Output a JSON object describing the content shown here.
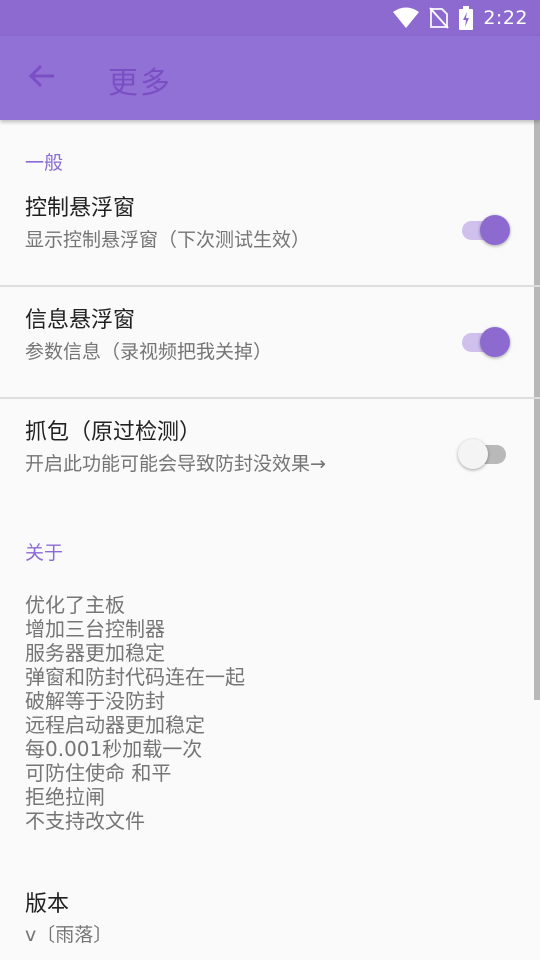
{
  "status_bar": {
    "time": "2:22",
    "icons": [
      "wifi-icon",
      "no-sim-icon",
      "battery-charging-icon"
    ]
  },
  "app_bar": {
    "back_icon": "arrow-left-icon",
    "title": "更多"
  },
  "sections": {
    "general_header": "一般",
    "about_header": "关于"
  },
  "preferences": [
    {
      "title": "控制悬浮窗",
      "summary": "显示控制悬浮窗（下次测试生效）",
      "checked": true
    },
    {
      "title": "信息悬浮窗",
      "summary": "参数信息（录视频把我关掉）",
      "checked": true
    },
    {
      "title": "抓包（原过检测）",
      "summary": "开启此功能可能会导致防封没效果→",
      "checked": false
    }
  ],
  "about_lines": [
    "优化了主板",
    "增加三台控制器",
    "服务器更加稳定",
    "弹窗和防封代码连在一起",
    "破解等于没防封",
    "远程启动器更加稳定",
    "每0.001秒加载一次",
    "可防住使命 和平",
    "拒绝拉闸",
    "不支持改文件"
  ],
  "version": {
    "title": "版本",
    "value": "v〔雨落〕"
  },
  "colors": {
    "status_bar": "#8c6ad0",
    "app_bar": "#9271d6",
    "accent": "#8c6ad0",
    "section_header": "#8a6bd6"
  }
}
